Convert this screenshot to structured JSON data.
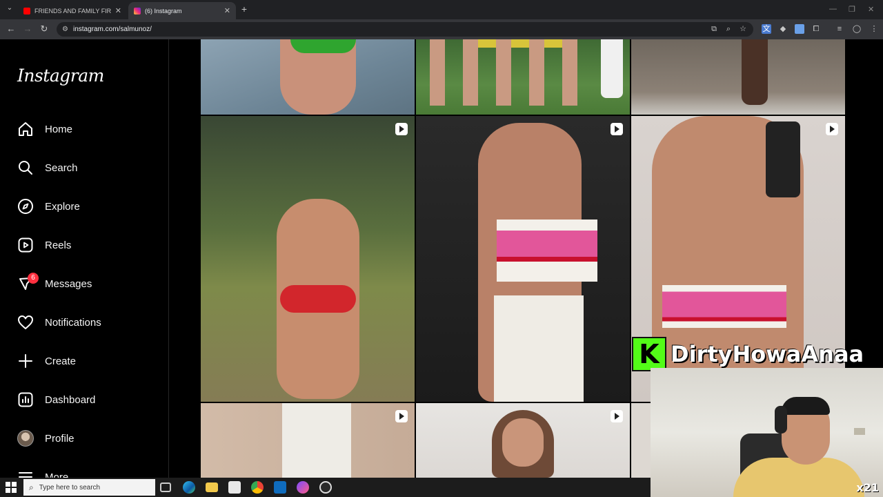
{
  "browser": {
    "tabs": [
      {
        "title": "FRIENDS AND FAMILY FIRST RE",
        "favicon": "youtube-icon",
        "active": false
      },
      {
        "title": "(6) Instagram",
        "favicon": "instagram-icon",
        "active": true
      }
    ],
    "new_tab_symbol": "+",
    "url": "instagram.com/salmunoz/"
  },
  "sidebar": {
    "logo": "Instagram",
    "items": [
      {
        "label": "Home",
        "icon": "home-icon"
      },
      {
        "label": "Search",
        "icon": "search-icon"
      },
      {
        "label": "Explore",
        "icon": "compass-icon"
      },
      {
        "label": "Reels",
        "icon": "reels-icon"
      },
      {
        "label": "Messages",
        "icon": "messenger-icon",
        "badge": "6"
      },
      {
        "label": "Notifications",
        "icon": "heart-icon"
      },
      {
        "label": "Create",
        "icon": "plus-icon"
      },
      {
        "label": "Dashboard",
        "icon": "dashboard-icon"
      },
      {
        "label": "Profile",
        "icon": "avatar"
      },
      {
        "label": "More",
        "icon": "menu-icon"
      }
    ]
  },
  "feed": {
    "tiles": [
      {
        "kind": "photo",
        "reel": false
      },
      {
        "kind": "photo",
        "reel": false
      },
      {
        "kind": "photo",
        "reel": false
      },
      {
        "kind": "reel",
        "reel": true
      },
      {
        "kind": "reel",
        "reel": true
      },
      {
        "kind": "reel",
        "reel": true
      },
      {
        "kind": "reel",
        "reel": true
      },
      {
        "kind": "reel",
        "reel": true
      },
      {
        "kind": "reel",
        "reel": false
      }
    ]
  },
  "overlay": {
    "logo_letter": "K",
    "streamer_name": "DirtyHowaAnaa",
    "watermark": "x21"
  },
  "taskbar": {
    "search_placeholder": "Type here to search"
  },
  "colors": {
    "ig_badge": "#ff3040",
    "kick_green": "#53fc18",
    "chrome_dark": "#202124",
    "chrome_toolbar": "#35363a"
  }
}
